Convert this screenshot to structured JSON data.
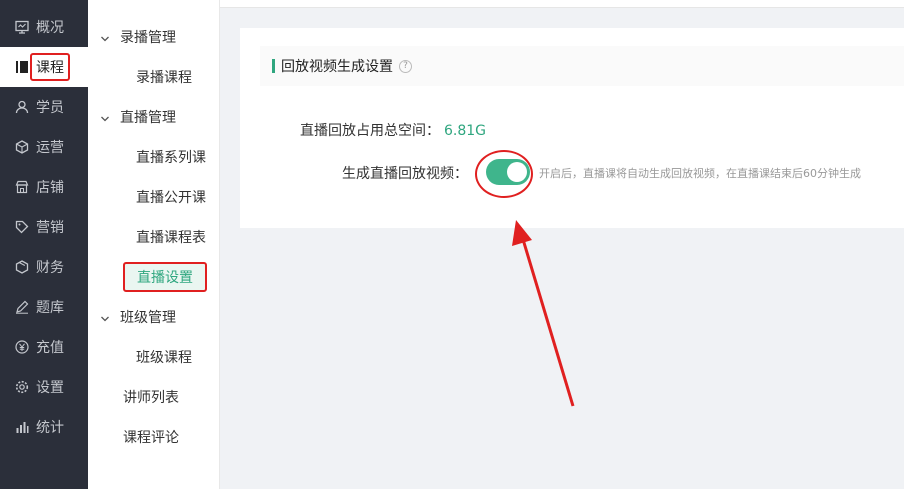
{
  "sidebar": {
    "items": [
      {
        "label": "概况",
        "icon": "monitor-icon"
      },
      {
        "label": "课程",
        "icon": "book-icon"
      },
      {
        "label": "学员",
        "icon": "user-icon"
      },
      {
        "label": "运营",
        "icon": "cube-icon"
      },
      {
        "label": "店铺",
        "icon": "store-icon"
      },
      {
        "label": "营销",
        "icon": "tag-icon"
      },
      {
        "label": "财务",
        "icon": "box-icon"
      },
      {
        "label": "题库",
        "icon": "pencil-icon"
      },
      {
        "label": "充值",
        "icon": "yuan-icon"
      },
      {
        "label": "设置",
        "icon": "gear-icon"
      },
      {
        "label": "统计",
        "icon": "chart-icon"
      }
    ]
  },
  "subnav": {
    "group_recorded": "录播管理",
    "recorded_course": "录播课程",
    "group_live": "直播管理",
    "live_series": "直播系列课",
    "live_public": "直播公开课",
    "live_schedule": "直播课程表",
    "live_settings": "直播设置",
    "group_class": "班级管理",
    "class_course": "班级课程",
    "teacher_list": "讲师列表",
    "course_reviews": "课程评论"
  },
  "main": {
    "section_title": "回放视频生成设置",
    "help_glyph": "?",
    "space_label": "直播回放占用总空间：",
    "space_value": "6.81G",
    "toggle_label": "生成直播回放视频：",
    "toggle_on": true,
    "toggle_hint": "开启后，直播课将自动生成回放视频，在直播课结束后60分钟生成"
  },
  "colors": {
    "accent": "#2fa67f",
    "toggle": "#3fb58c",
    "annotation": "#e02020",
    "sidebar_bg": "#2b2f3a"
  }
}
